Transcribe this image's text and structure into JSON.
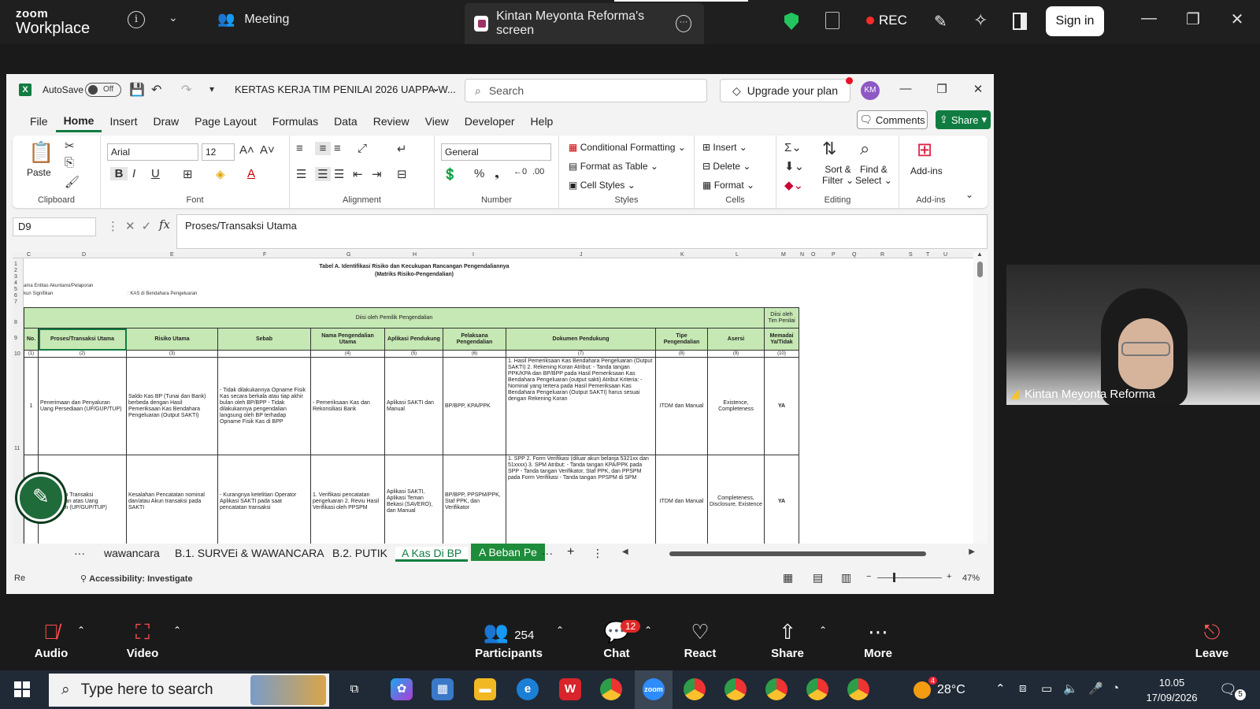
{
  "zoom_top": {
    "logo_small": "zoom",
    "logo_big": "Workplace",
    "info_glyph": "i",
    "meeting_label": "Meeting",
    "screen_tab_label": "Kintan Meyonta Reforma's screen",
    "more_glyph": "···",
    "rec_label": "REC",
    "signin_label": "Sign in",
    "win_min": "—",
    "win_restore": "❐",
    "win_close": "✕"
  },
  "excel": {
    "logo_letter": "X",
    "autosave_label": "AutoSave",
    "autosave_state": "Off",
    "filename": "KERTAS KERJA TIM PENILAI 2026 UAPPA-W...",
    "search_placeholder": "Search",
    "upgrade_label": "Upgrade your plan",
    "avatar_initials": "KM",
    "menu": [
      "File",
      "Home",
      "Insert",
      "Draw",
      "Page Layout",
      "Formulas",
      "Data",
      "Review",
      "View",
      "Developer",
      "Help"
    ],
    "active_menu": "Home",
    "comments_label": "Comments",
    "share_label": "Share",
    "ribbon": {
      "clipboard": {
        "paste": "Paste",
        "label": "Clipboard"
      },
      "font": {
        "name": "Arial",
        "size": "12",
        "label": "Font"
      },
      "alignment": {
        "label": "Alignment"
      },
      "number": {
        "format": "General",
        "label": "Number"
      },
      "styles": {
        "conditional": "Conditional Formatting",
        "format_table": "Format as Table",
        "cell_styles": "Cell Styles",
        "label": "Styles"
      },
      "cells": {
        "insert": "Insert",
        "delete": "Delete",
        "format": "Format",
        "label": "Cells"
      },
      "editing": {
        "sort": "Sort &",
        "filter": "Filter",
        "find": "Find &",
        "select": "Select",
        "label": "Editing"
      },
      "addins": {
        "name": "Add-ins",
        "label": "Add-ins"
      }
    },
    "name_box": "D9",
    "formula": "Proses/Transaksi Utama",
    "sheet": {
      "col_headers": [
        "C",
        "D",
        "E",
        "F",
        "G",
        "H",
        "I",
        "J",
        "K",
        "L",
        "M",
        "N",
        "O",
        "P",
        "Q",
        "R",
        "S",
        "T",
        "U"
      ],
      "row_headers": [
        "1",
        "2",
        "3",
        "4",
        "5",
        "6",
        "7",
        "8",
        "9",
        "10",
        "11"
      ],
      "title_line1": "Tabel A. Identifikasi Risiko dan Kecukupan Rancangan Pengendaliannya",
      "title_line2": "(Matriks Risiko-Pengendalian)",
      "meta1": "ama Entitas Akuntansi/Pelaporan",
      "meta2": "kun Signifikan",
      "meta3": ": KAS di Bendahara Pengeluaran",
      "filled_by_owner": "Diisi oleh Pemilik Pengendalian",
      "filled_by_team": "Diisi oleh Tim Penilai",
      "headers": [
        "No.",
        "Proses/Transaksi Utama",
        "Risiko Utama",
        "Sebab",
        "Nama Pengendalian Utama",
        "Aplikasi Pendukung",
        "Pelaksana Pengendalian",
        "Dokumen Pendukung",
        "Tipe Pengendalian",
        "Asersi",
        "Memadai Ya/Tidak"
      ],
      "numbering": [
        "(1)",
        "(2)",
        "(3)",
        "",
        "(4)",
        "(5)",
        "(6)",
        "(7)",
        "(8)",
        "(9)",
        "(10)"
      ],
      "rows": [
        {
          "no": "1",
          "proses": "Penerimaan dan Penyaluran Uang Persediaan (UP/GUP/TUP)",
          "risiko": "Saldo Kas BP (Tunai dan Bank) berbeda dengan Hasil Pemeriksaan Kas Bendahara Pengeluaran (Output SAKTI)",
          "sebab": "- Tidak dilakukannya Opname Fisik Kas secara berkala atau tiap akhir bulan oleh BP/BPP - Tidak dilakukannya pengendalian langsung oleh BP terhadap Opname Fisik Kas di BPP",
          "nama": "- Pemeriksaan Kas dan Rekonsiliasi Bank",
          "aplikasi": "Aplikasi SAKTI dan Manual",
          "pelaksana": "BP/BPP, KPA/PPK",
          "dokumen": "1. Hasil Pemeriksaan Kas Bendahara Pengeluaran (Output SAKTI) 2. Rekening Koran Atribut: - Tanda tangan PPK/KPA dan BP/BPP pada Hasil Pemeriksaan Kas Bendahara Pengeluaran (output sakti) Atribut Kriteria: - Nominal yang tertera pada Hasil Pemeriksaan Kas Bendahara Pengeluaran (Output SAKTI) harus sesuai dengan Rekening Koran",
          "tipe": "ITDM dan Manual",
          "asersi": "Existence, Completeness",
          "memadai": "YA"
        },
        {
          "no": "2",
          "proses": "Pencatatan Transaksi Pengeluaran atas Uang Persediaan (UP/GUP/TUP)",
          "risiko": "Kesalahan Pencatatan nominal dan/atau Akun transaksi pada SAKTI",
          "sebab": "- Kurangnya ketelitian Operator Aplikasi SAKTI pada saat pencatatan transaksi",
          "nama": "1. Verifikasi pencatatan pengeluaran 2. Reviu Hasil Verifikasi oleh PPSPM",
          "aplikasi": "Aplikasi SAKTI, Aplikasi Teman Bekasi (SAVERO), dan Manual",
          "pelaksana": "BP/BPP, PPSPM/PPK, Staf PPK, dan Verifikator",
          "dokumen": "1. SPP 2. Form Verifikasi (diluar akun belanja 5321xx dan 51xxxx) 3. SPM Atribut: - Tanda tangan KPA/PPK pada SPP - Tanda tangan Verifikator, Staf PPK, dan PPSPM pada Form Verifikasi - Tanda tangan PPSPM di SPM",
          "tipe": "ITDM dan Manual",
          "asersi": "Completeness, Disclosure, Existence",
          "memadai": "YA"
        }
      ]
    },
    "tabs": [
      "wawancara",
      "B.1. SURVEi & WAWANCARA",
      "B.2. PUTIK",
      "A Kas Di BP",
      "A Beban Pe"
    ],
    "active_tab": "A Kas Di BP",
    "status_left": "Re",
    "accessibility": "Accessibility: Investigate",
    "zoom_level": "47%"
  },
  "video": {
    "participant_name": "Kintan Meyonta Reforma"
  },
  "zoom_bottom": {
    "audio": "Audio",
    "video": "Video",
    "participants": "Participants",
    "participants_count": "254",
    "chat": "Chat",
    "chat_badge": "12",
    "react": "React",
    "share": "Share",
    "more": "More",
    "leave": "Leave"
  },
  "taskbar": {
    "search_placeholder": "Type here to search",
    "temperature": "28°C",
    "weather_badge": "4",
    "time": "10.05",
    "date": "17/09/2026",
    "notif_count": "5"
  },
  "colors": {
    "excel_green": "#107c41",
    "header_green": "#c6e8b4",
    "rec_red": "#ff2a2a"
  }
}
